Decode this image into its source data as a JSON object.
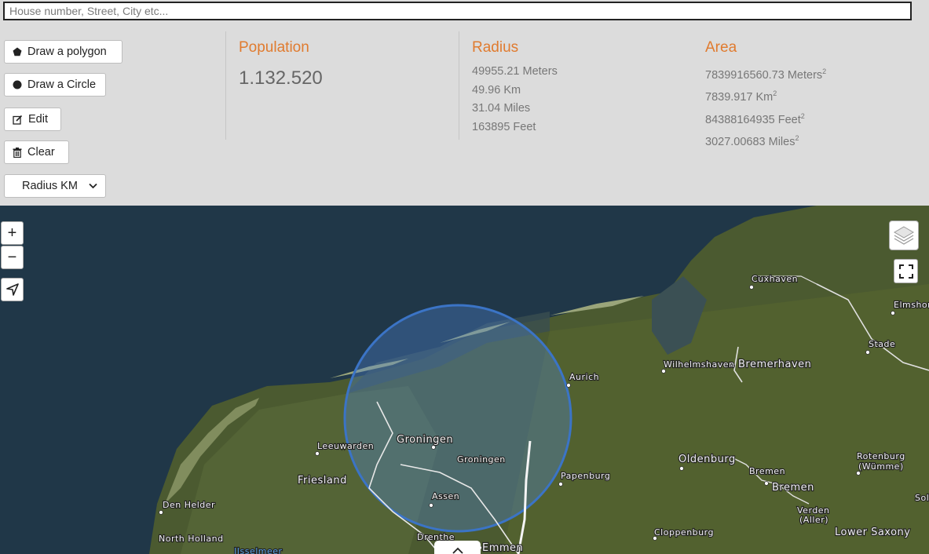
{
  "search": {
    "placeholder": "House number, Street, City etc..."
  },
  "buttons": {
    "polygon": "Draw a polygon",
    "circle": "Draw a Circle",
    "edit": "Edit",
    "clear": "Clear",
    "radius_select": "Radius KM"
  },
  "population": {
    "title": "Population",
    "value": "1.132.520"
  },
  "radius": {
    "title": "Radius",
    "lines": [
      "49955.21 Meters",
      "49.96 Km",
      "31.04 Miles",
      "163895 Feet"
    ]
  },
  "area": {
    "title": "Area",
    "lines": [
      {
        "value": "7839916560.73 Meters",
        "sup": "2"
      },
      {
        "value": "7839.917 Km",
        "sup": "2"
      },
      {
        "value": "84388164935 Feet",
        "sup": "2"
      },
      {
        "value": "3027.00683 Miles",
        "sup": "2"
      }
    ]
  },
  "map": {
    "controls": {
      "zoom_in": "+",
      "zoom_out": "−"
    },
    "labels": {
      "cuxhaven": "Cuxhaven",
      "elmshorn": "Elmshor",
      "stade": "Stade",
      "wilhelmshaven": "Wilhelmshaven",
      "bremerhaven": "Bremerhaven",
      "aurich": "Aurich",
      "leeuwarden": "Leeuwarden",
      "groningen_city": "Groningen",
      "groningen_prov": "Groningen",
      "friesland": "Friesland",
      "papenburg": "Papenburg",
      "oldenburg": "Oldenburg",
      "rotenburg1": "Rotenburg",
      "rotenburg2": "(Wümme)",
      "bremen1": "Bremen",
      "bremen2": "Bremen",
      "assen": "Assen",
      "den_helder": "Den Helder",
      "verden1": "Verden",
      "verden2": "(Aller)",
      "north_holland": "North Holland",
      "drenthe": "Drenthe",
      "emmen": "Emmen",
      "cloppenburg": "Cloppenburg",
      "lower_saxony": "Lower Saxony",
      "sol": "Sol",
      "ijsselmeer": "IJsselmeer"
    },
    "colors": {
      "circle_stroke": "#3b74c6",
      "circle_fill": "#4f86d8",
      "water": "#1f3647",
      "land": "#4a5a2f"
    }
  }
}
